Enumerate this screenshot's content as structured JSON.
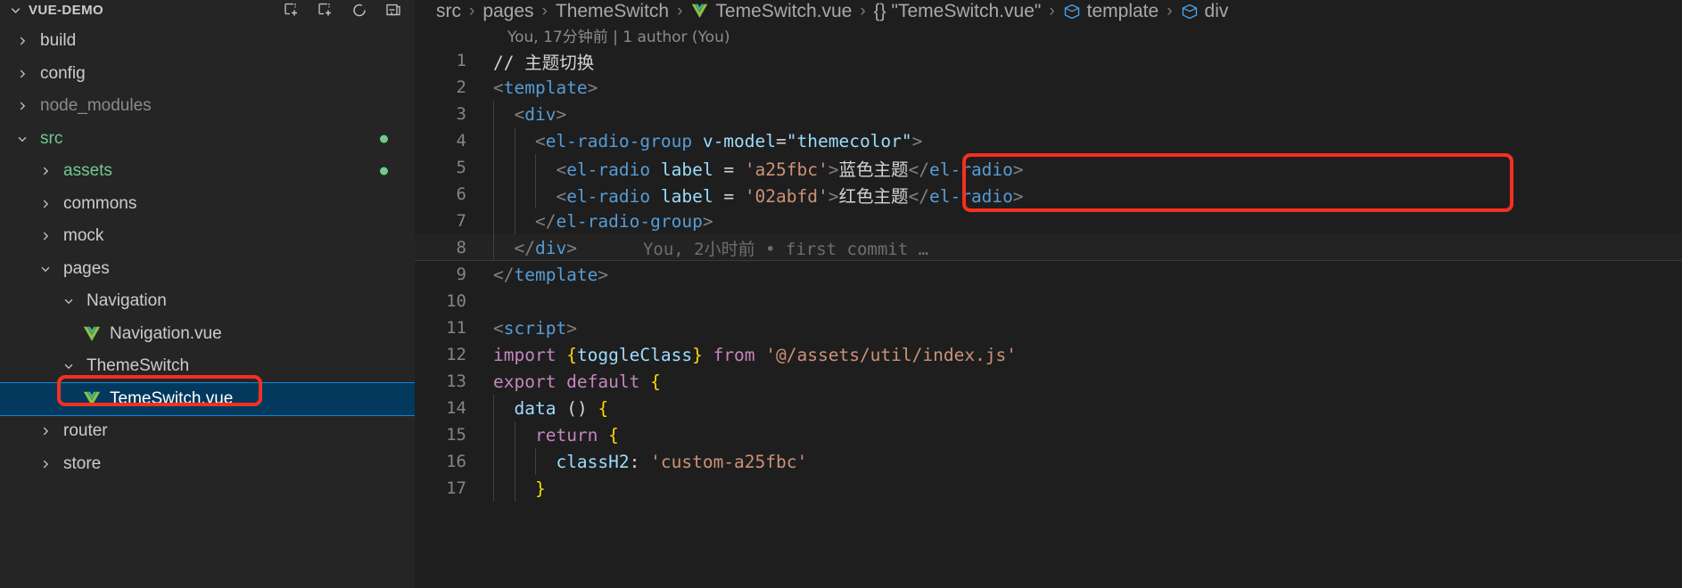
{
  "window": {
    "theme": "vscode-dark"
  },
  "colors": {
    "background": "#1e1e1e",
    "sidebar_background": "#252526",
    "selection": "#04395e",
    "selection_border": "#0a84d8",
    "annotation": "#f4301f",
    "accent_green": "#73c991",
    "tag_blue": "#569cd6",
    "attr_blue": "#9cdcfe",
    "string_orange": "#ce9178",
    "keyword_purple": "#c586c0",
    "brace_yellow": "#ffd700"
  },
  "sidebar": {
    "root_label": "VUE-DEMO",
    "actions": [
      {
        "name": "new-file-icon",
        "title": "New File"
      },
      {
        "name": "new-folder-icon",
        "title": "New Folder"
      },
      {
        "name": "refresh-icon",
        "title": "Refresh Explorer"
      },
      {
        "name": "collapse-all-icon",
        "title": "Collapse Folders in Explorer"
      }
    ],
    "items": [
      {
        "label": "build",
        "indent": 1,
        "kind": "folder",
        "state": "collapsed",
        "style": "normal",
        "dot": false,
        "selected": false
      },
      {
        "label": "config",
        "indent": 1,
        "kind": "folder",
        "state": "collapsed",
        "style": "normal",
        "dot": false,
        "selected": false
      },
      {
        "label": "node_modules",
        "indent": 1,
        "kind": "folder",
        "state": "collapsed",
        "style": "dim",
        "dot": false,
        "selected": false
      },
      {
        "label": "src",
        "indent": 1,
        "kind": "folder",
        "state": "expanded",
        "style": "green",
        "dot": true,
        "selected": false
      },
      {
        "label": "assets",
        "indent": 2,
        "kind": "folder",
        "state": "collapsed",
        "style": "green",
        "dot": true,
        "selected": false
      },
      {
        "label": "commons",
        "indent": 2,
        "kind": "folder",
        "state": "collapsed",
        "style": "normal",
        "dot": false,
        "selected": false
      },
      {
        "label": "mock",
        "indent": 2,
        "kind": "folder",
        "state": "collapsed",
        "style": "normal",
        "dot": false,
        "selected": false
      },
      {
        "label": "pages",
        "indent": 2,
        "kind": "folder",
        "state": "expanded",
        "style": "normal",
        "dot": false,
        "selected": false
      },
      {
        "label": "Navigation",
        "indent": 3,
        "kind": "folder",
        "state": "expanded",
        "style": "normal",
        "dot": false,
        "selected": false
      },
      {
        "label": "Navigation.vue",
        "indent": 4,
        "kind": "vuefile",
        "state": "none",
        "style": "normal",
        "dot": false,
        "selected": false
      },
      {
        "label": "ThemeSwitch",
        "indent": 3,
        "kind": "folder",
        "state": "expanded",
        "style": "normal",
        "dot": false,
        "selected": false
      },
      {
        "label": "TemeSwitch.vue",
        "indent": 4,
        "kind": "vuefile",
        "state": "none",
        "style": "normal",
        "dot": false,
        "selected": true
      },
      {
        "label": "router",
        "indent": 2,
        "kind": "folder",
        "state": "collapsed",
        "style": "normal",
        "dot": false,
        "selected": false
      },
      {
        "label": "store",
        "indent": 2,
        "kind": "folder",
        "state": "collapsed",
        "style": "normal",
        "dot": false,
        "selected": false
      }
    ]
  },
  "breadcrumb": {
    "segments": [
      {
        "label": "src",
        "icon": ""
      },
      {
        "label": "pages",
        "icon": ""
      },
      {
        "label": "ThemeSwitch",
        "icon": ""
      },
      {
        "label": "TemeSwitch.vue",
        "icon": "vue-icon"
      },
      {
        "label": "{} \"TemeSwitch.vue\"",
        "icon": ""
      },
      {
        "label": "template",
        "icon": "symbol-field-icon"
      },
      {
        "label": "div",
        "icon": "symbol-field-icon"
      }
    ],
    "separator": "›"
  },
  "blame": {
    "file_header": "You, 17分钟前 | 1 author (You)",
    "inline_line8": "You, 2小时前 • first commit …"
  },
  "editor": {
    "lines": [
      {
        "n": "1",
        "indent": 0,
        "tokens": [
          {
            "c": "t-comment",
            "t": "// 主题切换"
          }
        ]
      },
      {
        "n": "2",
        "indent": 0,
        "tokens": [
          {
            "c": "t-punct",
            "t": "<"
          },
          {
            "c": "t-tag",
            "t": "template"
          },
          {
            "c": "t-punct",
            "t": ">"
          }
        ]
      },
      {
        "n": "3",
        "indent": 1,
        "tokens": [
          {
            "c": "t-punct",
            "t": "  <"
          },
          {
            "c": "t-tag",
            "t": "div"
          },
          {
            "c": "t-punct",
            "t": ">"
          }
        ]
      },
      {
        "n": "4",
        "indent": 2,
        "tokens": [
          {
            "c": "t-punct",
            "t": "    <"
          },
          {
            "c": "t-tag",
            "t": "el-radio-group"
          },
          {
            "c": "t-text",
            "t": " "
          },
          {
            "c": "t-attr",
            "t": "v-model"
          },
          {
            "c": "t-op",
            "t": "="
          },
          {
            "c": "t-attr",
            "t": "\"themecolor\""
          },
          {
            "c": "t-punct",
            "t": ">"
          }
        ]
      },
      {
        "n": "5",
        "indent": 3,
        "tokens": [
          {
            "c": "t-punct",
            "t": "      <"
          },
          {
            "c": "t-tag",
            "t": "el-radio"
          },
          {
            "c": "t-text",
            "t": " "
          },
          {
            "c": "t-attr",
            "t": "label"
          },
          {
            "c": "t-text",
            "t": " "
          },
          {
            "c": "t-op",
            "t": "="
          },
          {
            "c": "t-text",
            "t": " "
          },
          {
            "c": "t-str",
            "t": "'a25fbc'"
          },
          {
            "c": "t-punct",
            "t": ">"
          },
          {
            "c": "t-text",
            "t": "蓝色主题"
          },
          {
            "c": "t-punct",
            "t": "</"
          },
          {
            "c": "t-tag",
            "t": "el-radio"
          },
          {
            "c": "t-punct",
            "t": ">"
          }
        ]
      },
      {
        "n": "6",
        "indent": 3,
        "tokens": [
          {
            "c": "t-punct",
            "t": "      <"
          },
          {
            "c": "t-tag",
            "t": "el-radio"
          },
          {
            "c": "t-text",
            "t": " "
          },
          {
            "c": "t-attr",
            "t": "label"
          },
          {
            "c": "t-text",
            "t": " "
          },
          {
            "c": "t-op",
            "t": "="
          },
          {
            "c": "t-text",
            "t": " "
          },
          {
            "c": "t-str",
            "t": "'02abfd'"
          },
          {
            "c": "t-punct",
            "t": ">"
          },
          {
            "c": "t-text",
            "t": "红色主题"
          },
          {
            "c": "t-punct",
            "t": "</"
          },
          {
            "c": "t-tag",
            "t": "el-radio"
          },
          {
            "c": "t-punct",
            "t": ">"
          }
        ]
      },
      {
        "n": "7",
        "indent": 2,
        "tokens": [
          {
            "c": "t-punct",
            "t": "    </"
          },
          {
            "c": "t-tag",
            "t": "el-radio-group"
          },
          {
            "c": "t-punct",
            "t": ">"
          }
        ]
      },
      {
        "n": "8",
        "indent": 1,
        "tokens": [
          {
            "c": "t-punct",
            "t": "  </"
          },
          {
            "c": "t-tag",
            "t": "div"
          },
          {
            "c": "t-punct",
            "t": ">"
          }
        ],
        "blame": true
      },
      {
        "n": "9",
        "indent": 0,
        "tokens": [
          {
            "c": "t-punct",
            "t": "</"
          },
          {
            "c": "t-tag",
            "t": "template"
          },
          {
            "c": "t-punct",
            "t": ">"
          }
        ]
      },
      {
        "n": "10",
        "indent": 0,
        "tokens": [
          {
            "c": "t-text",
            "t": ""
          }
        ]
      },
      {
        "n": "11",
        "indent": 0,
        "tokens": [
          {
            "c": "t-punct",
            "t": "<"
          },
          {
            "c": "t-tag",
            "t": "script"
          },
          {
            "c": "t-punct",
            "t": ">"
          }
        ]
      },
      {
        "n": "12",
        "indent": 0,
        "tokens": [
          {
            "c": "t-kw",
            "t": "import "
          },
          {
            "c": "t-brace",
            "t": "{"
          },
          {
            "c": "t-fn",
            "t": "toggleClass"
          },
          {
            "c": "t-brace",
            "t": "}"
          },
          {
            "c": "t-kw",
            "t": " from "
          },
          {
            "c": "t-str",
            "t": "'@/assets/util/index.js'"
          }
        ]
      },
      {
        "n": "13",
        "indent": 0,
        "tokens": [
          {
            "c": "t-kw",
            "t": "export default "
          },
          {
            "c": "t-brace",
            "t": "{"
          }
        ]
      },
      {
        "n": "14",
        "indent": 1,
        "tokens": [
          {
            "c": "t-text",
            "t": "  "
          },
          {
            "c": "t-fn",
            "t": "data"
          },
          {
            "c": "t-text",
            "t": " "
          },
          {
            "c": "t-op",
            "t": "() "
          },
          {
            "c": "t-brace",
            "t": "{"
          }
        ]
      },
      {
        "n": "15",
        "indent": 2,
        "tokens": [
          {
            "c": "t-text",
            "t": "    "
          },
          {
            "c": "t-kw",
            "t": "return"
          },
          {
            "c": "t-text",
            "t": " "
          },
          {
            "c": "t-brace",
            "t": "{"
          }
        ]
      },
      {
        "n": "16",
        "indent": 3,
        "tokens": [
          {
            "c": "t-text",
            "t": "      "
          },
          {
            "c": "t-prop",
            "t": "classH2"
          },
          {
            "c": "t-op",
            "t": ": "
          },
          {
            "c": "t-str",
            "t": "'custom-a25fbc'"
          }
        ]
      },
      {
        "n": "17",
        "indent": 2,
        "tokens": [
          {
            "c": "t-text",
            "t": "    "
          },
          {
            "c": "t-brace",
            "t": "}"
          }
        ]
      }
    ]
  },
  "annotations": [
    {
      "name": "annotation-box-file",
      "target": "TemeSwitch.vue sidebar entry"
    },
    {
      "name": "annotation-box-code",
      "target": "code lines 5 and 6"
    }
  ]
}
